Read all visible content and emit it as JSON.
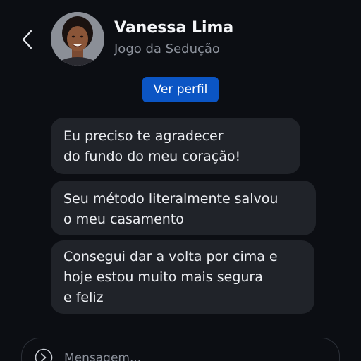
{
  "header": {
    "back_icon": "chevron-left-icon",
    "contact_name": "Vanessa Lima",
    "contact_subtitle": "Jogo da Sedução",
    "profile_button_label": "Ver perfil"
  },
  "messages": [
    {
      "lines": [
        "Eu preciso te agradecer",
        "do fundo do meu coração!"
      ]
    },
    {
      "lines": [
        "Seu método literalmente salvou",
        "o meu casamento"
      ]
    },
    {
      "lines": [
        "Consegui dar a volta por cima e",
        "hoje estou muito mais segura",
        "e feliz"
      ]
    }
  ],
  "composer": {
    "placeholder": "Mensagem...",
    "icon": "send-circle-icon"
  },
  "colors": {
    "background": "#0c0e13",
    "bubble": "#202329",
    "accent": "#0b55c4",
    "muted_text": "#8d929c"
  }
}
